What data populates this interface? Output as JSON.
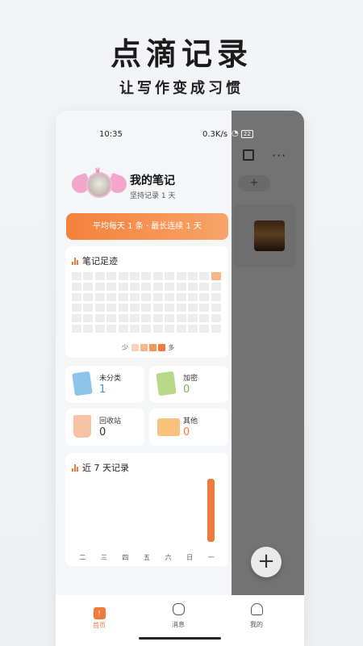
{
  "promo": {
    "title": "点滴记录",
    "subtitle": "让写作变成习惯"
  },
  "status_bar": {
    "time": "10:35",
    "network_speed": "0.3K/s",
    "battery": "22"
  },
  "profile": {
    "name": "我的笔记",
    "subtitle": "坚持记录 1 天"
  },
  "banner": {
    "text": "平均每天 1 条 · 最长连续 1 天"
  },
  "footprint": {
    "title": "笔记足迹",
    "grid_rows": 6,
    "grid_cols": 13,
    "active_cell": {
      "row": 0,
      "col": 12
    },
    "legend_less": "少",
    "legend_more": "多",
    "legend_colors": [
      "#fbd2b5",
      "#f8b58a",
      "#f49659",
      "#f07a3c"
    ]
  },
  "categories": [
    {
      "label": "未分类",
      "count": "1",
      "icon": "book-icon",
      "color": "#4a90c8"
    },
    {
      "label": "加密",
      "count": "0",
      "icon": "locked-notebook-icon",
      "color": "#7bb35a"
    },
    {
      "label": "回收站",
      "count": "0",
      "icon": "recycle-bin-icon",
      "color": "#333333"
    },
    {
      "label": "其他",
      "count": "0",
      "icon": "folder-icon",
      "color": "#f07a3c"
    }
  ],
  "weekly": {
    "title": "近 7 天记录"
  },
  "chart_data": {
    "type": "bar",
    "categories": [
      "二",
      "三",
      "四",
      "五",
      "六",
      "日",
      "一"
    ],
    "values": [
      0,
      0,
      0,
      0,
      0,
      0,
      1
    ],
    "title": "近 7 天记录",
    "ylim": [
      0,
      1
    ]
  },
  "tabs": [
    {
      "label": "首页",
      "icon": "home-icon",
      "active": true
    },
    {
      "label": "消息",
      "icon": "message-icon",
      "active": false
    },
    {
      "label": "我的",
      "icon": "profile-icon",
      "active": false
    }
  ],
  "background_app": {
    "add_chip": "+",
    "more": "···",
    "fab": "+"
  },
  "colors": {
    "accent": "#f07a3c",
    "overlay": "#000000"
  }
}
